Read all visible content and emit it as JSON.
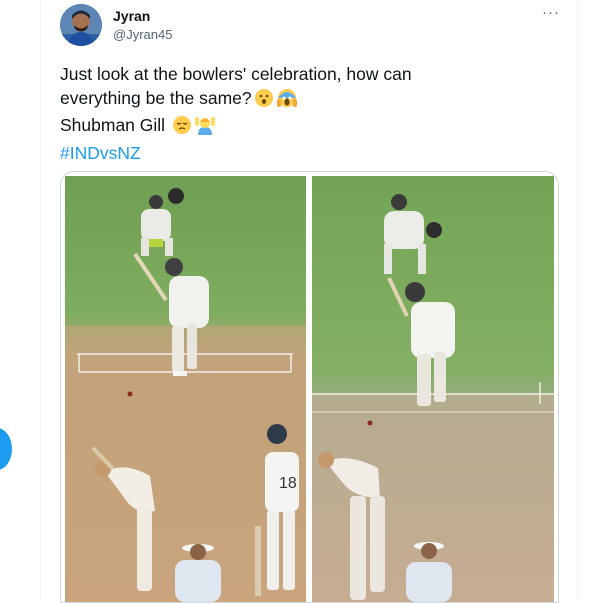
{
  "tweet": {
    "author_name": "Jyran",
    "author_handle": "@Jyran45",
    "more_label": "···",
    "lines": [
      "Just look at the bowlers' celebration, how can",
      "everything be the same?"
    ],
    "player_line": "Shubman Gill",
    "hashtag": "#INDvsNZ",
    "emojis": [
      "hushed-face-emoji",
      "screaming-face-emoji",
      "relieved-face-emoji",
      "person-raising-hands-emoji"
    ]
  },
  "media": {
    "frames": [
      {
        "name": "cricket-frame-left",
        "jersey_text": "18"
      },
      {
        "name": "cricket-frame-right"
      }
    ]
  },
  "colors": {
    "link": "#1d9bf0",
    "text": "#0f1419",
    "secondary": "#536471",
    "pitch_green": "#7aa55c",
    "pitch_brown": "#c9a47c"
  }
}
